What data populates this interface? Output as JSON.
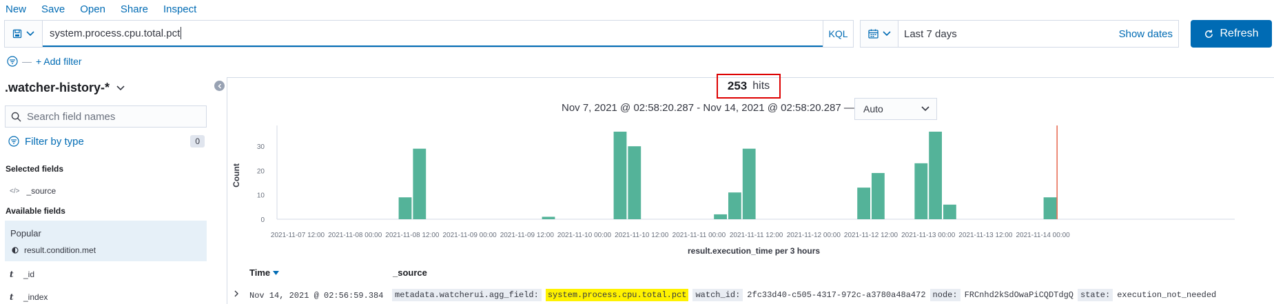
{
  "menu": [
    "New",
    "Save",
    "Open",
    "Share",
    "Inspect"
  ],
  "query": {
    "value": "system.process.cpu.total.pct",
    "language": "KQL"
  },
  "date": {
    "range": "Last 7 days",
    "show_dates": "Show dates"
  },
  "refresh_label": "Refresh",
  "filter": {
    "add_label": "+ Add filter"
  },
  "sidebar": {
    "index_pattern": ".watcher-history-*",
    "search_placeholder": "Search field names",
    "filter_by_type": "Filter by type",
    "filter_count": "0",
    "selected_title": "Selected fields",
    "selected_fields": [
      "_source"
    ],
    "available_title": "Available fields",
    "popular_title": "Popular",
    "popular_fields": [
      "result.condition.met"
    ],
    "fields": [
      "_id",
      "_index"
    ]
  },
  "results": {
    "hits_count": "253",
    "hits_label": "hits",
    "time_range": "Nov 7, 2021 @ 02:58:20.287 - Nov 14, 2021 @ 02:58:20.287 —",
    "interval": "Auto"
  },
  "chart_data": {
    "type": "bar",
    "ylabel": "Count",
    "xlabel": "result.execution_time per 3 hours",
    "ylim": [
      0,
      36
    ],
    "yticks": [
      0,
      10,
      20,
      30
    ],
    "xticks": [
      "2021-11-07 12:00",
      "2021-11-08 00:00",
      "2021-11-08 12:00",
      "2021-11-09 00:00",
      "2021-11-09 12:00",
      "2021-11-10 00:00",
      "2021-11-10 12:00",
      "2021-11-11 00:00",
      "2021-11-11 12:00",
      "2021-11-12 00:00",
      "2021-11-12 12:00",
      "2021-11-13 00:00",
      "2021-11-13 12:00",
      "2021-11-14 00:00"
    ],
    "bars": [
      {
        "bucket": "2021-11-08 09:00",
        "value": 9
      },
      {
        "bucket": "2021-11-08 12:00",
        "value": 29
      },
      {
        "bucket": "2021-11-09 15:00",
        "value": 1
      },
      {
        "bucket": "2021-11-10 06:00",
        "value": 36
      },
      {
        "bucket": "2021-11-10 09:00",
        "value": 30
      },
      {
        "bucket": "2021-11-11 03:00",
        "value": 2
      },
      {
        "bucket": "2021-11-11 06:00",
        "value": 11
      },
      {
        "bucket": "2021-11-11 09:00",
        "value": 29
      },
      {
        "bucket": "2021-11-12 09:00",
        "value": 13
      },
      {
        "bucket": "2021-11-12 12:00",
        "value": 19
      },
      {
        "bucket": "2021-11-12 21:00",
        "value": 23
      },
      {
        "bucket": "2021-11-13 00:00",
        "value": 36
      },
      {
        "bucket": "2021-11-13 03:00",
        "value": 6
      },
      {
        "bucket": "2021-11-14 00:00",
        "value": 9
      }
    ],
    "bar_color": "#54b399",
    "now_marker_color": "#e7664c"
  },
  "table": {
    "time_header": "Time",
    "source_header": "_source",
    "rows": [
      {
        "time": "Nov 14, 2021 @ 02:56:59.384",
        "k1": "metadata.watcherui.agg_field:",
        "v1": "system.process.cpu.total.pct",
        "k2": "watch_id:",
        "v2": "2fc33d40-c505-4317-972c-a3780a48a472",
        "k3": "node:",
        "v3": "FRCnhd2kSdOwaPiCQDTdgQ",
        "k4": "state:",
        "v4": "execution_not_needed"
      }
    ]
  }
}
